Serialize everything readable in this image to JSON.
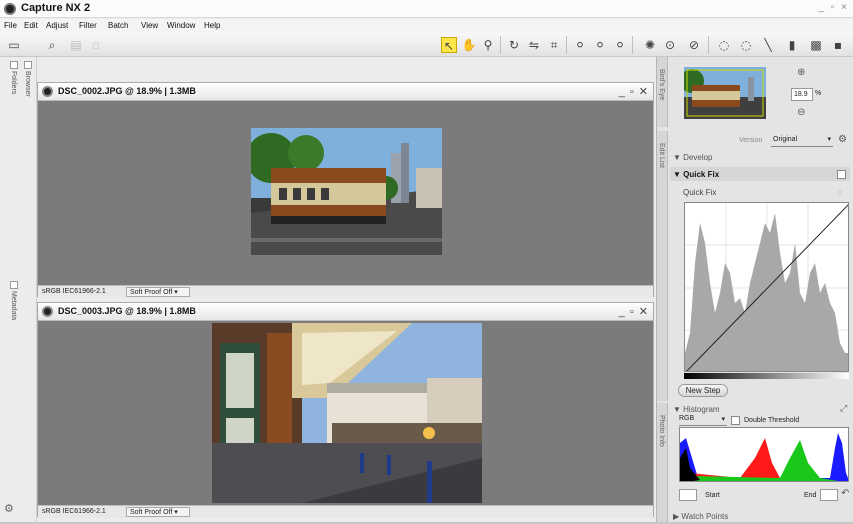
{
  "app": {
    "title": "Capture NX 2",
    "window_controls": "_ ▫ ×"
  },
  "menu": [
    "File",
    "Edit",
    "Adjust",
    "Filter",
    "Batch",
    "View",
    "Window",
    "Help"
  ],
  "left_rail": {
    "tabs": [
      "Folders",
      "Browser",
      "Metadata"
    ]
  },
  "windows": [
    {
      "title": "DSC_0002.JPG @ 18.9% | 1.3MB",
      "profile": "sRGB IEC61966-2.1",
      "proof": "Soft Proof Off"
    },
    {
      "title": "DSC_0003.JPG @ 18.9% | 1.8MB",
      "profile": "sRGB IEC61966-2.1",
      "proof": "Soft Proof Off"
    }
  ],
  "birds_eye": {
    "tab": "Bird's Eye",
    "zoom": "18.9",
    "unit": "%"
  },
  "edit_list": {
    "tab": "Edit List",
    "version_label": "Version",
    "version_value": "Original",
    "develop": "Develop",
    "quick_fix_header": "Quick Fix",
    "quick_fix_label": "Quick Fix",
    "new_step": "New Step"
  },
  "photo_info": {
    "tab": "Photo Info",
    "histogram": "Histogram",
    "channel": "RGB",
    "double_threshold": "Double Threshold",
    "start": "Start",
    "end": "End",
    "watch_points": "Watch Points"
  },
  "colors": {
    "canvas": "#7b7b7b",
    "panel": "#e4e4e4"
  }
}
